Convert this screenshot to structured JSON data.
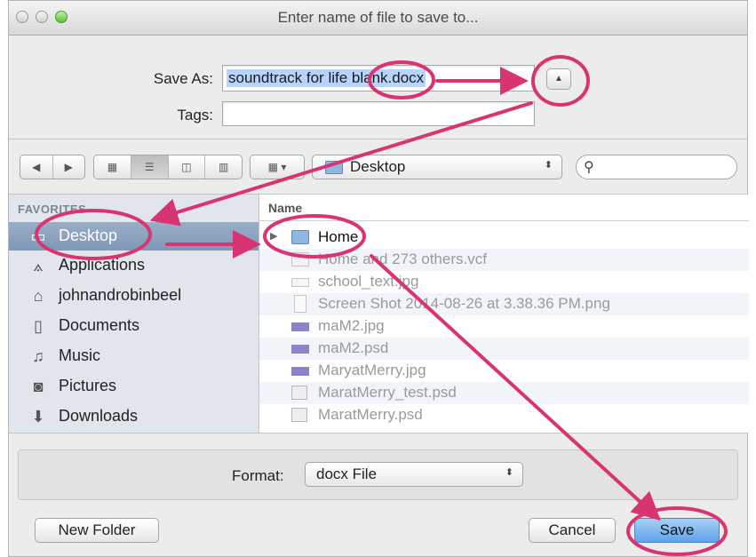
{
  "window": {
    "title": "Enter name of file to save to..."
  },
  "save_as": {
    "label": "Save As:",
    "value": "soundtrack for life blank.docx"
  },
  "tags": {
    "label": "Tags:",
    "value": ""
  },
  "toolbar": {
    "location": "Desktop"
  },
  "sidebar": {
    "header": "FAVORITES",
    "items": [
      {
        "label": "Desktop",
        "icon": "desktop-icon",
        "selected": true
      },
      {
        "label": "Applications",
        "icon": "applications-icon"
      },
      {
        "label": "johnandrobinbeel",
        "icon": "home-icon"
      },
      {
        "label": "Documents",
        "icon": "documents-icon"
      },
      {
        "label": "Music",
        "icon": "music-icon"
      },
      {
        "label": "Pictures",
        "icon": "camera-icon"
      },
      {
        "label": "Downloads",
        "icon": "download-icon"
      }
    ]
  },
  "file_list": {
    "column_header": "Name",
    "rows": [
      {
        "name": "Home",
        "type": "folder"
      },
      {
        "name": "Home and 273 others.vcf",
        "type": "file"
      },
      {
        "name": "school_text.jpg",
        "type": "file"
      },
      {
        "name": "Screen Shot 2014-08-26 at 3.38.36 PM.png",
        "type": "file"
      },
      {
        "name": "maM2.jpg",
        "type": "image"
      },
      {
        "name": "maM2.psd",
        "type": "image"
      },
      {
        "name": "MaryatMerry.jpg",
        "type": "image"
      },
      {
        "name": "MaratMerry_test.psd",
        "type": "psd"
      },
      {
        "name": "MaratMerry.psd",
        "type": "psd"
      }
    ]
  },
  "format": {
    "label": "Format:",
    "value": "docx File"
  },
  "buttons": {
    "new_folder": "New Folder",
    "cancel": "Cancel",
    "save": "Save"
  },
  "colors": {
    "annotation": "#d93472",
    "selection": "#b5d5ff",
    "sidebar_selected": "#8aa1c0",
    "default_button": "#5fa2ea"
  }
}
